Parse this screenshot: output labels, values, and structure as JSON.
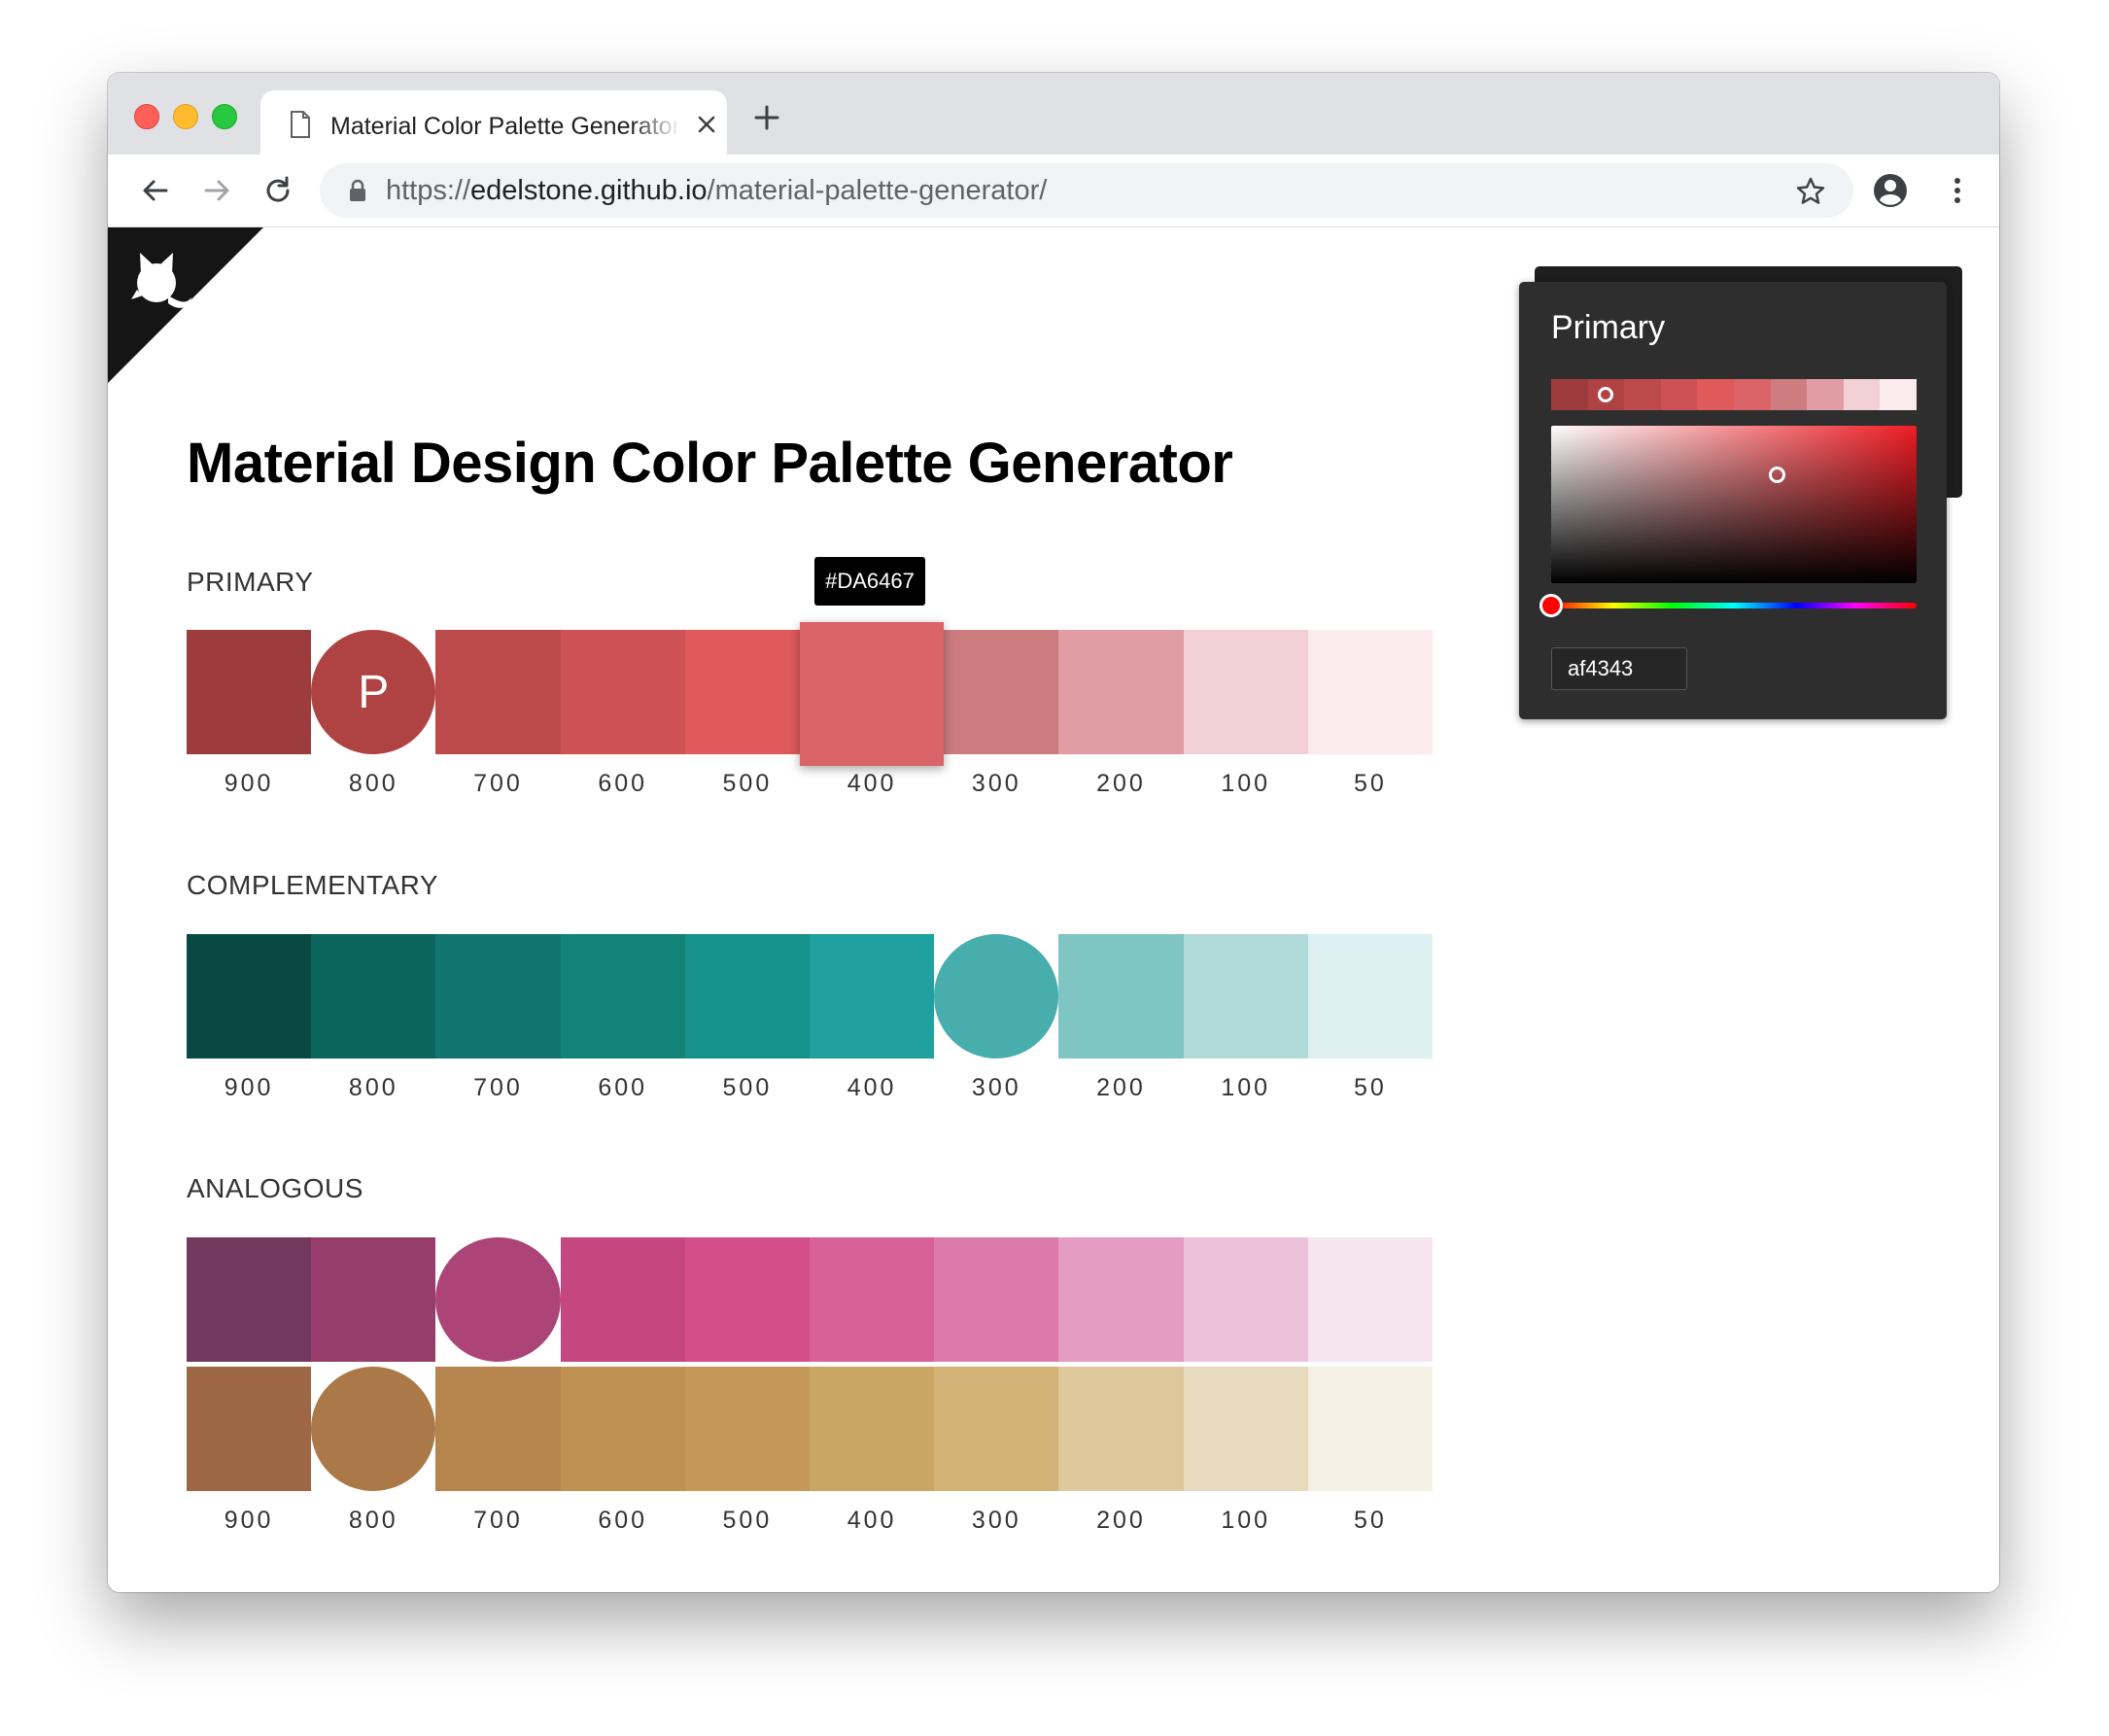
{
  "browser": {
    "tab_title": "Material Color Palette Generator",
    "url_scheme": "https://",
    "url_host": "edelstone.github.io",
    "url_path": "/material-palette-generator/"
  },
  "page": {
    "title": "Material Design Color Palette Generator",
    "tooltip": "#DA6467"
  },
  "sections": {
    "primary": {
      "label": "PRIMARY",
      "circle_letter": "P",
      "colors": [
        "#9d3c3c",
        "#af4343",
        "#bd4a4b",
        "#cd5253",
        "#de5a5b",
        "#da6467",
        "#cd7d7f",
        "#e09ea4",
        "#f2d0d5",
        "#fbeaee"
      ]
    },
    "complementary": {
      "label": "COMPLEMENTARY",
      "colors": [
        "#084a43",
        "#0b645d",
        "#11746d",
        "#138378",
        "#16918b",
        "#20a09e",
        "#48adad",
        "#7fc5c4",
        "#b0dbda",
        "#dff0f3"
      ]
    },
    "analogous": {
      "label": "ANALOGOUS",
      "colors_a": [
        "#72385e",
        "#973d6c",
        "#ad4477",
        "#c4487f",
        "#d44f89",
        "#d86298",
        "#dc7aab",
        "#e49cc3",
        "#ebc2da",
        "#f6e5ef"
      ],
      "colors_b": [
        "#9d6745",
        "#ab7848",
        "#b6854e",
        "#bf9153",
        "#c39859",
        "#caa664",
        "#d4b378",
        "#dec89c",
        "#e7dabd",
        "#f5f0e4"
      ]
    }
  },
  "shade_labels": [
    "900",
    "800",
    "700",
    "600",
    "500",
    "400",
    "300",
    "200",
    "100",
    "50"
  ],
  "picker": {
    "title": "Primary",
    "hex_value": "af4343",
    "hue_color": "#ee1d24",
    "shades": [
      "#9d3c3c",
      "#af4343",
      "#bd4a4b",
      "#cd5253",
      "#de5a5b",
      "#da6467",
      "#cd7d7f",
      "#e09ea4",
      "#f2d0d5",
      "#fbeaee"
    ]
  },
  "colors": {
    "chrome_bar": "#dfe1e5",
    "omnibox": "#f1f3f4",
    "panel_bg": "#2e2e2e",
    "corner": "#151515"
  },
  "icons": [
    "page-icon",
    "close-icon",
    "plus-icon",
    "back-arrow-icon",
    "forward-arrow-icon",
    "reload-icon",
    "lock-icon",
    "star-icon",
    "account-icon",
    "more-vert-icon",
    "github-octocat-icon"
  ]
}
